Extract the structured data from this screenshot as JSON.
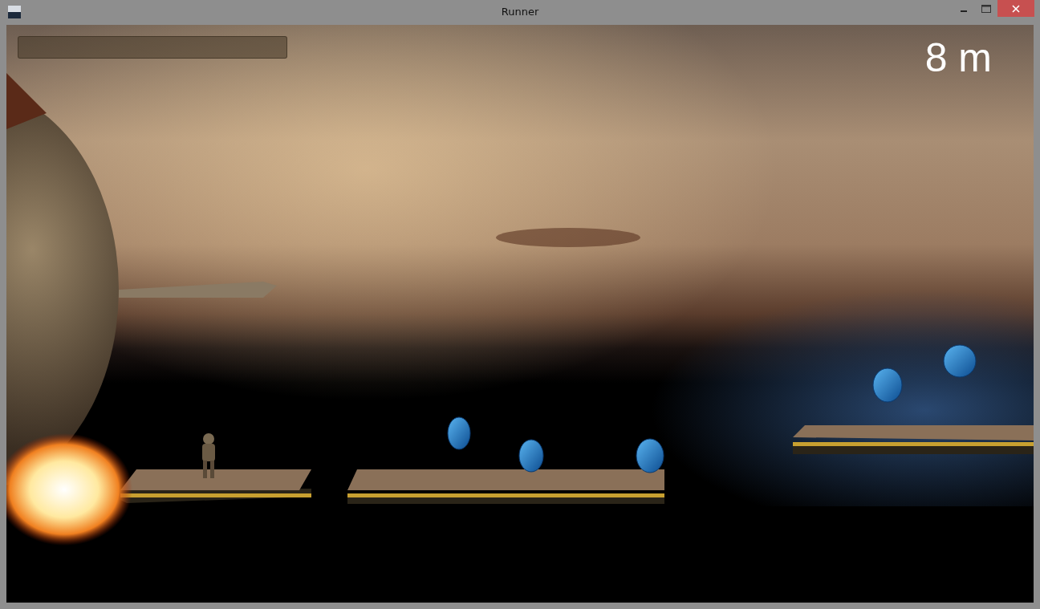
{
  "window": {
    "title": "Runner"
  },
  "hud": {
    "meter": {
      "level": 0
    },
    "distance": "8 m"
  }
}
